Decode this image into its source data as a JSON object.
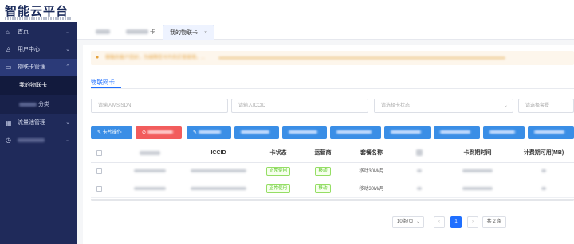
{
  "app": {
    "logo": "智能云平台"
  },
  "sidebar": {
    "items": [
      {
        "label": "首页",
        "icon": "home-icon"
      },
      {
        "label": "用户中心",
        "icon": "user-icon"
      },
      {
        "label": "物联卡管理",
        "icon": "card-icon"
      },
      {
        "label": "我的物联卡"
      },
      {
        "label": "分类"
      },
      {
        "label": "流量池管理",
        "icon": "grid-icon"
      },
      {
        "icon": "clock-icon"
      }
    ]
  },
  "tabs": [
    {
      "label": "卡"
    },
    {
      "label": "我的物联卡",
      "close": "×"
    }
  ],
  "notice": {
    "text": "尊敬的客户您好，为保障您卡片的正常使用，..."
  },
  "page": {
    "subtitle": "物联网卡"
  },
  "filters": {
    "msisdn_placeholder": "请输入MSISDN",
    "iccid_placeholder": "请输入ICCID",
    "status_placeholder": "请选择卡状态",
    "package_placeholder": "请选择套餐"
  },
  "buttons": {
    "card_ops": "卡片操作"
  },
  "table": {
    "columns": {
      "iccid": "ICCID",
      "status": "卡状态",
      "operator": "运营商",
      "package": "套餐名称",
      "expiry": "卡到期时间",
      "billing": "计费期可用(MB)"
    },
    "rows": [
      {
        "status": "正常使用",
        "operator": "移动",
        "package": "移动30M/月"
      },
      {
        "status": "正常使用",
        "operator": "移动",
        "package": "移动30M/月"
      }
    ]
  },
  "pagination": {
    "page_size": "10条/页",
    "prev": "‹",
    "current": "1",
    "next": "›",
    "total": "共 2 条"
  },
  "colors": {
    "sidebar": "#1f2a5a",
    "primary": "#1f6fff",
    "warning": "#e6a23c",
    "success": "#52c41a"
  }
}
